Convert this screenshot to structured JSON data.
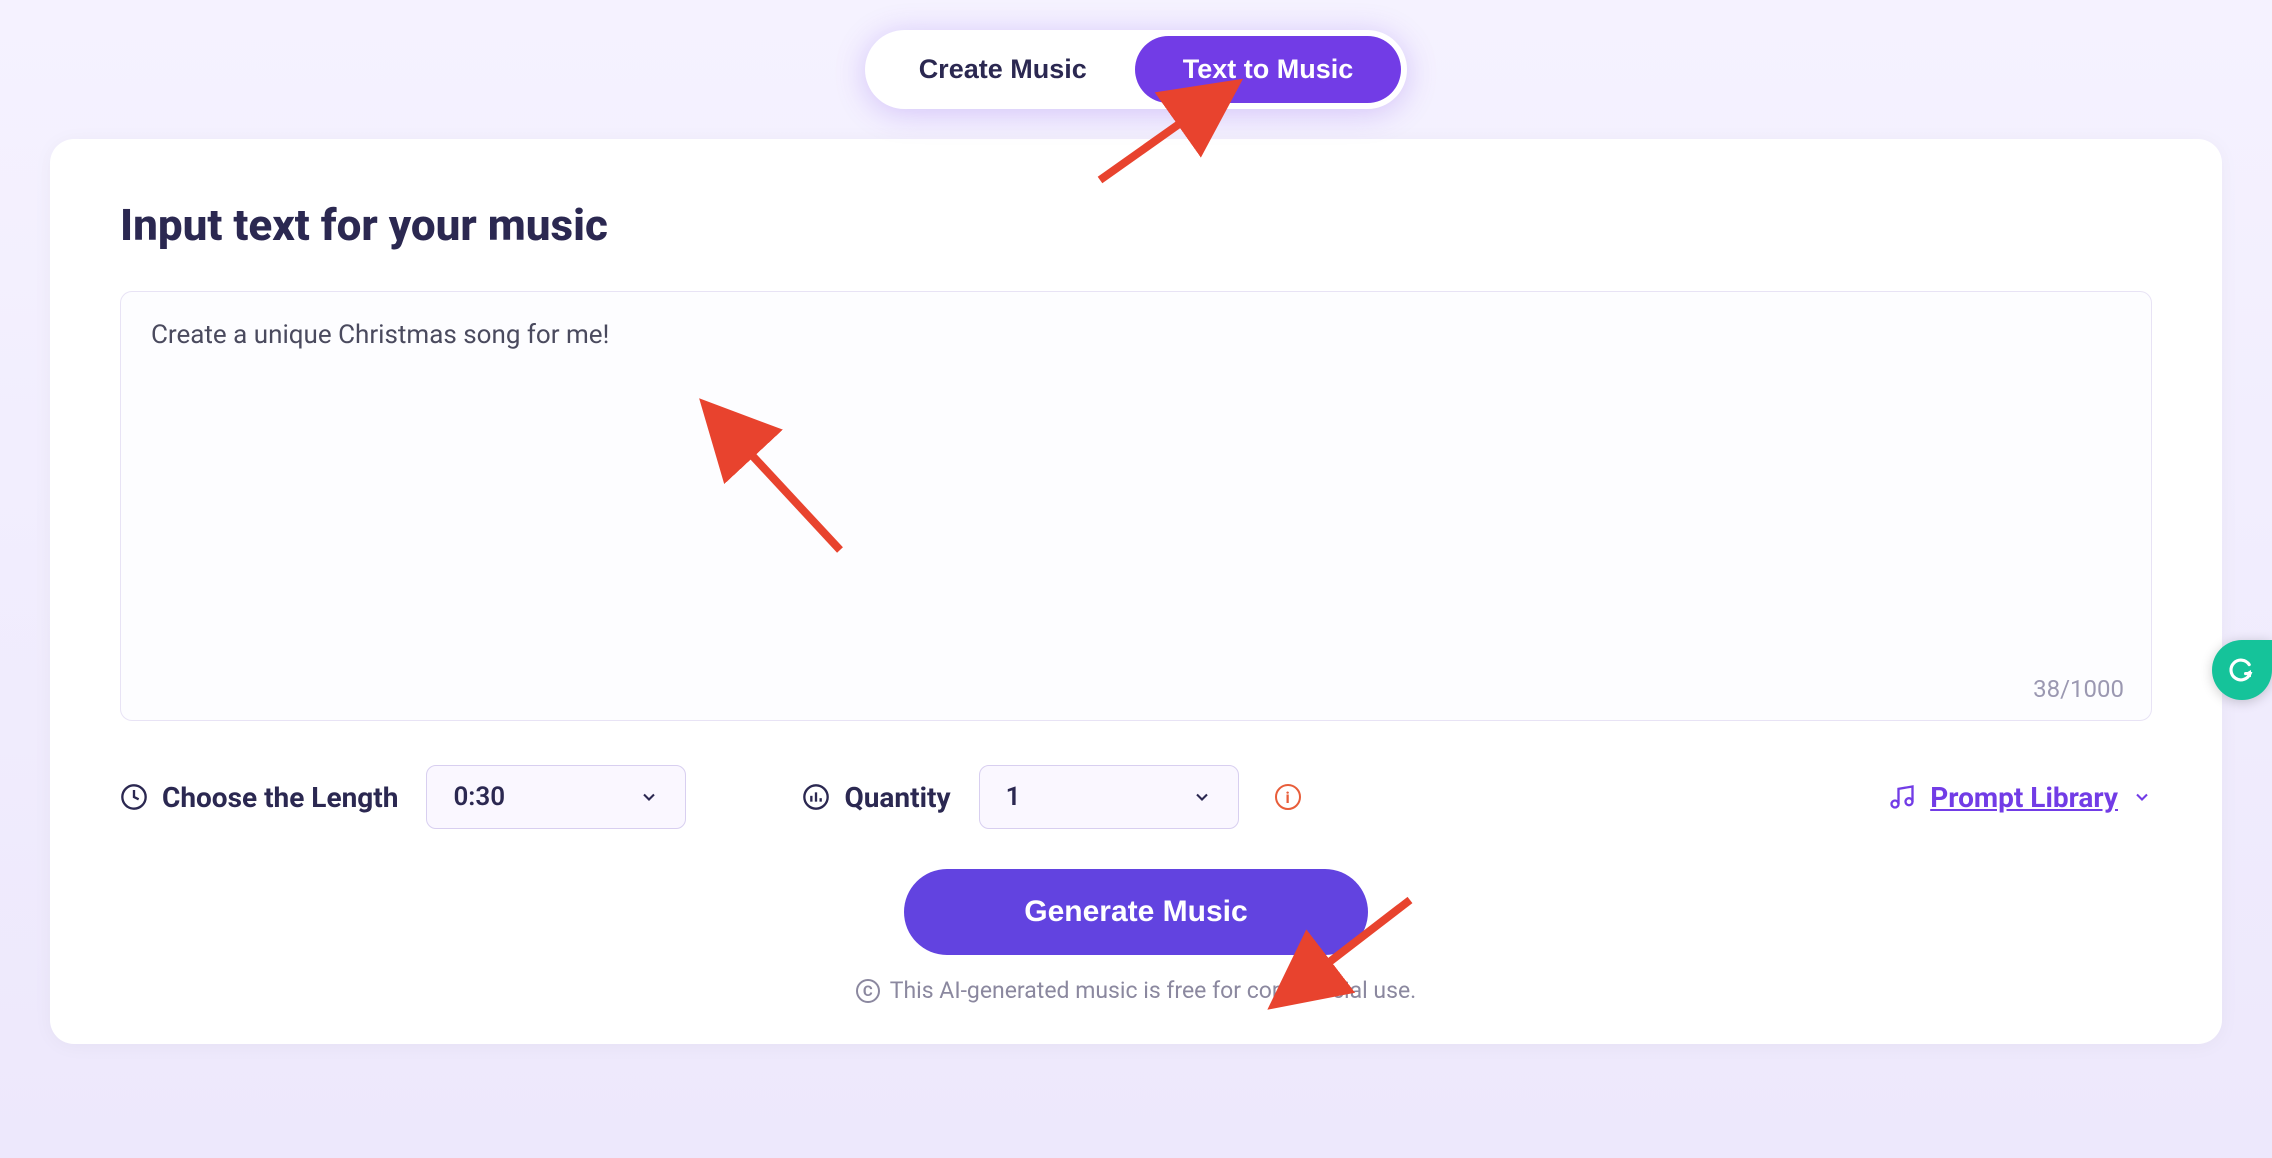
{
  "tabs": {
    "create_music": "Create Music",
    "text_to_music": "Text to Music"
  },
  "heading": "Input text for your music",
  "prompt_text": "Create a unique Christmas song for me!",
  "char_counter": "38/1000",
  "length": {
    "label": "Choose the Length",
    "value": "0:30"
  },
  "quantity": {
    "label": "Quantity",
    "value": "1"
  },
  "prompt_library_label": "Prompt Library",
  "generate_button": "Generate Music",
  "disclaimer": "This AI-generated music is free for commercial use."
}
